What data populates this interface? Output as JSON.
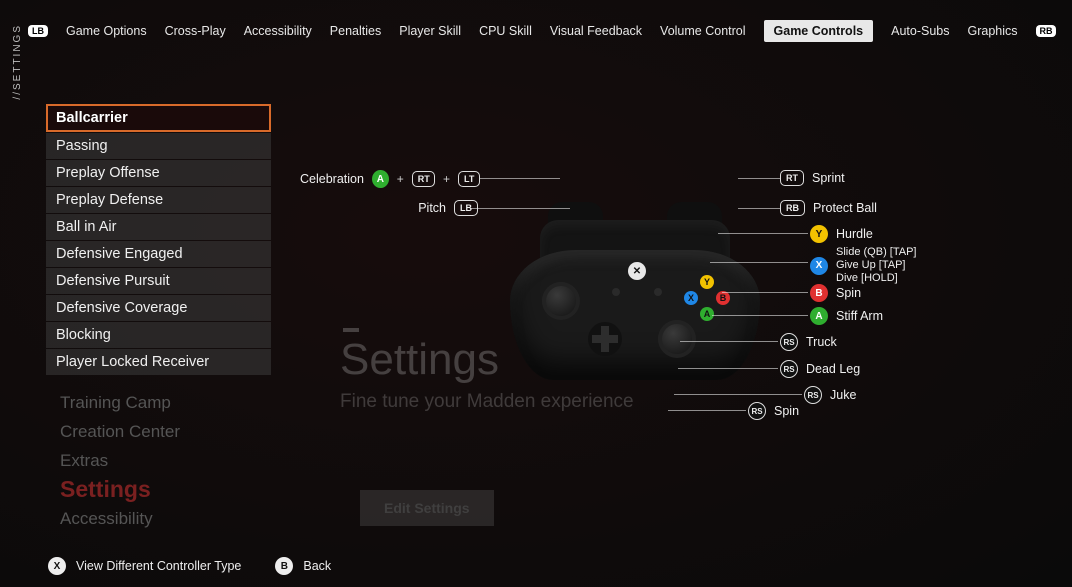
{
  "vstrip": "//SETTINGS",
  "bumpers": {
    "lb": "LB",
    "rb": "RB"
  },
  "tabs": [
    "Game Options",
    "Cross-Play",
    "Accessibility",
    "Penalties",
    "Player Skill",
    "CPU Skill",
    "Visual Feedback",
    "Volume Control",
    "Game Controls",
    "Auto-Subs",
    "Graphics"
  ],
  "active_tab_index": 8,
  "categories": [
    "Ballcarrier",
    "Passing",
    "Preplay Offense",
    "Preplay Defense",
    "Ball in Air",
    "Defensive Engaged",
    "Defensive Pursuit",
    "Defensive Coverage",
    "Blocking",
    "Player Locked Receiver"
  ],
  "selected_category_index": 0,
  "ghost_menu": {
    "items": [
      "Training Camp",
      "Creation Center",
      "Extras"
    ],
    "settings": "Settings",
    "accessibility": "Accessibility"
  },
  "ghost_big": {
    "title": "Settings",
    "sub": "Fine tune your Madden experience",
    "button": "Edit Settings"
  },
  "controls_left": {
    "celebration": {
      "label": "Celebration",
      "a": "A",
      "rt": "RT",
      "lt": "LT"
    },
    "pitch": {
      "label": "Pitch",
      "lb": "LB"
    }
  },
  "controls_right": {
    "sprint": {
      "btn": "RT",
      "label": "Sprint"
    },
    "protect": {
      "btn": "RB",
      "label": "Protect Ball"
    },
    "hurdle": {
      "btn": "Y",
      "label": "Hurdle"
    },
    "xmove": {
      "btn": "X",
      "lines": [
        "Slide (QB) [TAP]",
        "Give Up [TAP]",
        "Dive [HOLD]"
      ]
    },
    "spin": {
      "btn": "B",
      "label": "Spin"
    },
    "stiff": {
      "btn": "A",
      "label": "Stiff Arm"
    },
    "truck": {
      "btn": "RS",
      "label": "Truck"
    },
    "deadleg": {
      "btn": "RS",
      "label": "Dead Leg"
    },
    "juke": {
      "btn": "RS",
      "label": "Juke"
    },
    "rsspin": {
      "btn": "RS",
      "label": "Spin"
    }
  },
  "footer": {
    "x": "X",
    "x_label": "View Different Controller Type",
    "b": "B",
    "b_label": "Back"
  }
}
